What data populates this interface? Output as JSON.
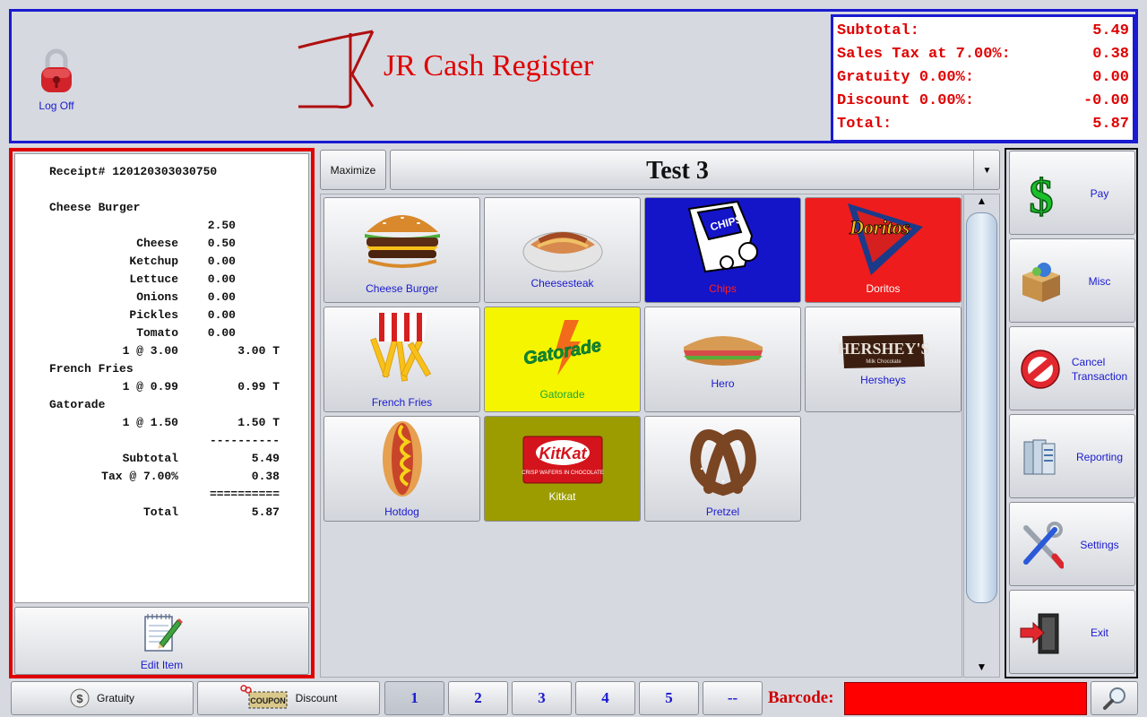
{
  "header": {
    "logoff_label": "Log Off",
    "app_title": "JR Cash Register",
    "totals": [
      {
        "label": "Subtotal:",
        "value": "5.49"
      },
      {
        "label": "Sales Tax at 7.00%:",
        "value": "0.38"
      },
      {
        "label": "Gratuity 0.00%:",
        "value": "0.00"
      },
      {
        "label": "Discount 0.00%:",
        "value": "-0.00"
      },
      {
        "label": "Total:",
        "value": "5.87"
      }
    ]
  },
  "receipt": {
    "number": "Receipt# 120120303030750",
    "lines": [
      {
        "a": "Cheese Burger",
        "b": "",
        "c": ""
      },
      {
        "a": "",
        "b": "2.50",
        "c": ""
      },
      {
        "a": "Cheese",
        "b": "0.50",
        "c": ""
      },
      {
        "a": "Ketchup",
        "b": "0.00",
        "c": ""
      },
      {
        "a": "Lettuce",
        "b": "0.00",
        "c": ""
      },
      {
        "a": "Onions",
        "b": "0.00",
        "c": ""
      },
      {
        "a": "Pickles",
        "b": "0.00",
        "c": ""
      },
      {
        "a": "Tomato",
        "b": "0.00",
        "c": ""
      },
      {
        "a": "1 @ 3.00",
        "b": "",
        "c": "3.00 T"
      },
      {
        "a": "French Fries",
        "b": "",
        "c": ""
      },
      {
        "a": "1 @ 0.99",
        "b": "",
        "c": "0.99 T"
      },
      {
        "a": "Gatorade",
        "b": "",
        "c": ""
      },
      {
        "a": "1 @ 1.50",
        "b": "",
        "c": "1.50 T"
      },
      {
        "a": "",
        "b": "",
        "c": "----------"
      },
      {
        "a": "Subtotal",
        "b": "",
        "c": "5.49"
      },
      {
        "a": "Tax @ 7.00%",
        "b": "",
        "c": "0.38"
      },
      {
        "a": "",
        "b": "",
        "c": "=========="
      },
      {
        "a": "Total",
        "b": "",
        "c": "5.87"
      }
    ],
    "edit_item_label": "Edit Item"
  },
  "toolbar": {
    "maximize_label": "Maximize",
    "category": "Test 3"
  },
  "items": [
    {
      "label": "Cheese Burger",
      "bg": "light",
      "icon": "burger-icon"
    },
    {
      "label": "Cheesesteak",
      "bg": "light",
      "icon": "cheesesteak-icon"
    },
    {
      "label": "Chips",
      "bg": "#1414c8",
      "icon": "chips-icon"
    },
    {
      "label": "Doritos",
      "bg": "#ee1c1c",
      "icon": "doritos-icon"
    },
    {
      "label": "French Fries",
      "bg": "light",
      "icon": "fries-icon"
    },
    {
      "label": "Gatorade",
      "bg": "#f5f500",
      "icon": "gatorade-icon"
    },
    {
      "label": "Hero",
      "bg": "light",
      "icon": "hero-sandwich-icon"
    },
    {
      "label": "Hersheys",
      "bg": "light",
      "icon": "hersheys-icon"
    },
    {
      "label": "Hotdog",
      "bg": "light",
      "icon": "hotdog-icon"
    },
    {
      "label": "Kitkat",
      "bg": "#9c9c00",
      "icon": "kitkat-icon"
    },
    {
      "label": "Pretzel",
      "bg": "light",
      "icon": "pretzel-icon"
    }
  ],
  "side_buttons": [
    {
      "label": "Pay",
      "icon": "dollar-icon"
    },
    {
      "label": "Misc",
      "icon": "box-icon"
    },
    {
      "label": "Cancel Transaction",
      "icon": "cancel-icon"
    },
    {
      "label": "Reporting",
      "icon": "reporting-icon"
    },
    {
      "label": "Settings",
      "icon": "settings-icon"
    },
    {
      "label": "Exit",
      "icon": "exit-icon"
    }
  ],
  "bottom": {
    "gratuity_label": "Gratuity",
    "discount_label": "Discount",
    "coupon_text": "COUPON",
    "pages": [
      "1",
      "2",
      "3",
      "4",
      "5",
      "--"
    ],
    "barcode_label": "Barcode:"
  },
  "colors": {
    "accent_red": "#e00000",
    "accent_blue": "#1a1ad0",
    "barcode_bg": "#ff0000"
  }
}
